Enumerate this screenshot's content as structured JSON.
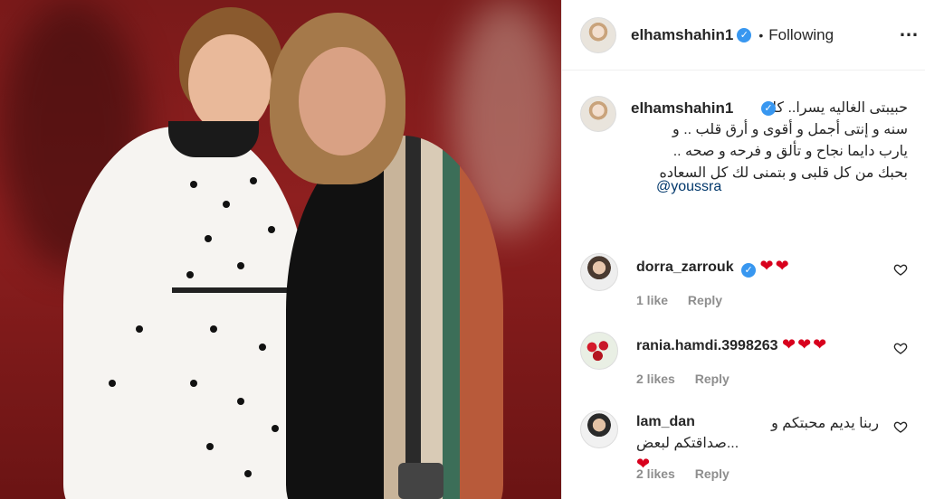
{
  "post": {
    "username": "elhamshahin1",
    "follow_separator": "•",
    "follow_status": "Following",
    "more_icon": "…"
  },
  "caption": {
    "username": "elhamshahin1",
    "text_lines": [
      "حبيبتى الغاليه يسرا.. كل",
      "سنه و إنتى أجمل و أقوى و أرق قلب .. و",
      "يارب دايما نجاح و تألق و فرحه و صحه ..",
      "بحبك من كل قلبى و بتمنى لك كل السعاده"
    ],
    "mention": "@youssra"
  },
  "comments": [
    {
      "username": "dorra_zarrouk",
      "text": "",
      "hearts": "❤❤",
      "likes": "1 like",
      "reply": "Reply"
    },
    {
      "username": "rania.hamdi.3998263",
      "text": "",
      "hearts": "❤❤❤",
      "likes": "2 likes",
      "reply": "Reply"
    },
    {
      "username": "lam_dan",
      "text_line1": "ربنا يديم محبتكم و",
      "text_line2": "صداقتكم لبعض...",
      "hearts": "❤",
      "likes": "2 likes",
      "reply": "Reply"
    }
  ],
  "colors": {
    "accent": "#3897f0",
    "heart": "#d8001d",
    "muted": "#8e8e8e",
    "mention": "#00376b"
  }
}
